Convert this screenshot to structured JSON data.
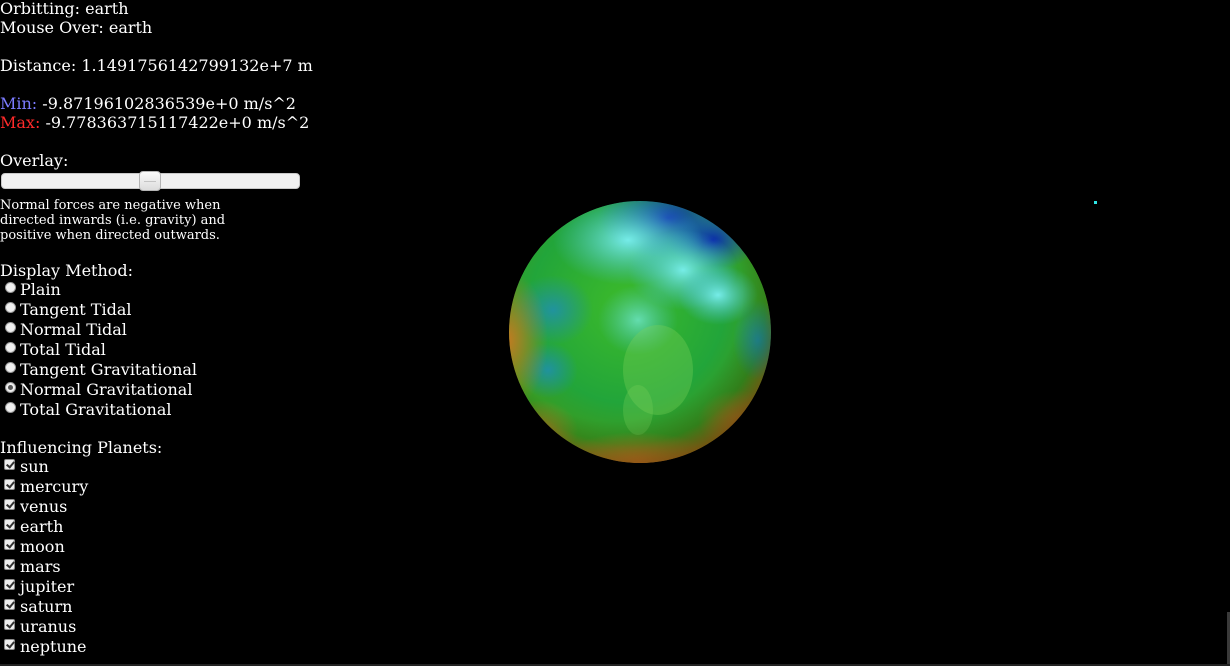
{
  "status": {
    "orbiting_label": "Orbitting:",
    "orbiting_value": "earth",
    "mouse_over_label": "Mouse Over:",
    "mouse_over_value": "earth",
    "distance_label": "Distance:",
    "distance_value": "1.1491756142799132e+7 m",
    "min_label": "Min:",
    "min_value": "-9.87196102836539e+0 m/s^2",
    "max_label": "Max:",
    "max_value": "-9.778363715117422e+0 m/s^2",
    "min_color": "#7b7bff",
    "max_color": "#ff2a2a"
  },
  "overlay": {
    "label": "Overlay:",
    "value_fraction": 0.5
  },
  "note": "Normal forces are negative when directed inwards (i.e. gravity) and positive when directed outwards.",
  "display_method": {
    "label": "Display Method:",
    "options": [
      {
        "label": "Plain",
        "checked": false
      },
      {
        "label": "Tangent Tidal",
        "checked": false
      },
      {
        "label": "Normal Tidal",
        "checked": false
      },
      {
        "label": "Total Tidal",
        "checked": false
      },
      {
        "label": "Tangent Gravitational",
        "checked": false
      },
      {
        "label": "Normal Gravitational",
        "checked": true
      },
      {
        "label": "Total Gravitational",
        "checked": false
      }
    ]
  },
  "influencing_planets": {
    "label": "Influencing Planets:",
    "items": [
      {
        "label": "sun",
        "checked": true
      },
      {
        "label": "mercury",
        "checked": true
      },
      {
        "label": "venus",
        "checked": true
      },
      {
        "label": "earth",
        "checked": true
      },
      {
        "label": "moon",
        "checked": true
      },
      {
        "label": "mars",
        "checked": true
      },
      {
        "label": "jupiter",
        "checked": true
      },
      {
        "label": "saturn",
        "checked": true
      },
      {
        "label": "uranus",
        "checked": true
      },
      {
        "label": "neptune",
        "checked": true
      }
    ]
  },
  "scene": {
    "background_color": "#000000",
    "star_color": "#2ee6e6",
    "globe_colors": [
      "#0b2fb0",
      "#1f8fd0",
      "#5ce6e6",
      "#22a53a",
      "#3dbb2a",
      "#c8a020",
      "#c4501c"
    ]
  }
}
